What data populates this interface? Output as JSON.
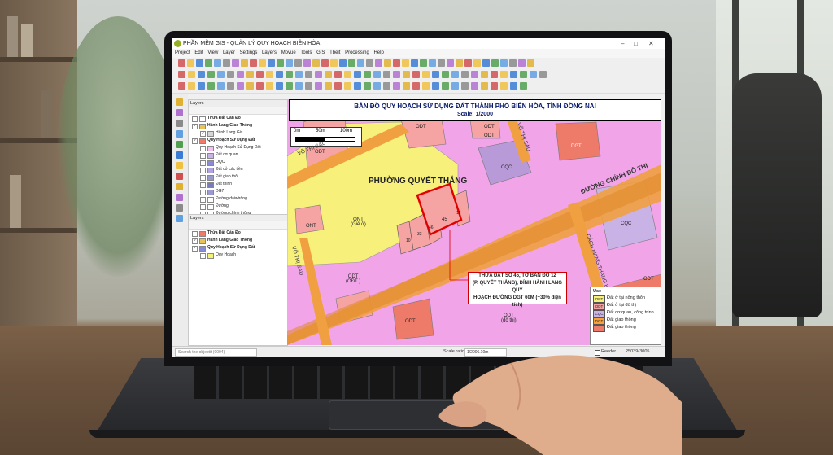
{
  "window": {
    "title": "PHẦN MỀM GIS - QUẢN LÝ QUY HOẠCH BIÊN HÒA",
    "controls": [
      "–",
      "□",
      "✕"
    ]
  },
  "menu": [
    "Project",
    "Edit",
    "View",
    "Layer",
    "Settings",
    "Layers",
    "Movue",
    "Tools",
    "GIS",
    "Tbeit",
    "Processing",
    "Help"
  ],
  "layers_panel_1": {
    "title": "Layers",
    "items": [
      {
        "label": "Thửa Đất Cán Đo",
        "bold": true,
        "checked": false,
        "swatch": "#ffffff"
      },
      {
        "label": "Hành Lang Giao Thông",
        "bold": true,
        "checked": true,
        "swatch": "#e8c35a"
      },
      {
        "label": "Hành Lang Gis",
        "bold": false,
        "checked": true,
        "swatch": "#d6d6d6"
      },
      {
        "label": "Quy Hoạch Sử Dụng Đất",
        "bold": true,
        "checked": true,
        "swatch": "#f07a6a"
      },
      {
        "label": "Quy Hoạch Sử Dụng Đất",
        "bold": false,
        "checked": false,
        "swatch": "#f5c1ee"
      },
      {
        "label": "Đất cơ quan",
        "bold": false,
        "checked": false,
        "swatch": "#c9b2e6"
      },
      {
        "label": "OQC",
        "bold": false,
        "checked": false,
        "swatch": "#8a8ad6"
      },
      {
        "label": "Đất cở các tiền",
        "bold": false,
        "checked": false,
        "swatch": "#b0a5e0"
      },
      {
        "label": "Đất giao thô",
        "bold": false,
        "checked": false,
        "swatch": "#9999cc"
      },
      {
        "label": "Đất thinh",
        "bold": false,
        "checked": false,
        "swatch": "#7a7ab8"
      },
      {
        "label": "DG7",
        "bold": false,
        "checked": false,
        "swatch": "#9b9bd0"
      },
      {
        "label": "Đường daiwtrông",
        "bold": false,
        "checked": false,
        "swatch": "#ffffff"
      },
      {
        "label": "Đường",
        "bold": false,
        "checked": false,
        "swatch": "#ffffff"
      },
      {
        "label": "Đường chính thông",
        "bold": false,
        "checked": false,
        "swatch": "#ffffff"
      }
    ]
  },
  "layers_panel_2": {
    "title": "Layers",
    "items": [
      {
        "label": "Thửa Đất Cán Đo",
        "bold": true,
        "checked": false,
        "swatch": "#f07a6a"
      },
      {
        "label": "Hành Lang Giao Thông",
        "bold": true,
        "checked": true,
        "swatch": "#e8c35a"
      },
      {
        "label": "Quy Hoạch Sử Dụng Đất",
        "bold": true,
        "checked": true,
        "swatch": "#8a8ad6"
      },
      {
        "label": "Quy Hoạch",
        "bold": false,
        "checked": false,
        "swatch": "#f5f07a"
      }
    ]
  },
  "map": {
    "title_line1": "BẢN ĐỒ QUY HOẠCH SỬ DỤNG ĐẤT THÀNH PHỐ BIÊN HÒA, TỈNH ĐỒNG NAI",
    "title_line2": "Scale: 1/2000",
    "scalebar": [
      "0m",
      "50m",
      "100m"
    ],
    "ward": "PHƯỜNG QUYẾT THẮNG",
    "streets": {
      "vo_thi_sau_1": "VÕ THỊ SÁU",
      "vo_thi_sau_2": "VÕ THỊ SÁU",
      "vo_thi_sau_3": "VÕ THỊ SÁU",
      "main_road": "ĐƯỜNG CHÍNH ĐÔ THỊ",
      "cach_mang": "CÁCH MẠNG THÁNG 8"
    },
    "zones": {
      "odt1": "ODT",
      "odt2": "ODT",
      "odt3": "ODT",
      "odt4": "ODT",
      "odt5_code": "ODT",
      "odt5_sub": "(OĐT )",
      "odt6": "ODT",
      "odt7_code": "ODT",
      "odt7_sub": "(đô thị)",
      "odt8": "ODT",
      "ont1": "ONT",
      "ont2_code": "ONT",
      "ont2_sub": "(Giê ở)",
      "dgt": "DGT",
      "cqc1": "CQC",
      "cqc2": "CQC"
    },
    "parcels": [
      "10",
      "33",
      "46",
      "45",
      "12"
    ],
    "callout": "THỬA ĐẤT SỐ 45, TỜ BẢN ĐỒ 12 (P. QUYẾT THẮNG), DÍNH HÀNH LANG QUY HOẠCH ĐƯỜNG DGT 60M (~30% diện tích)",
    "callout_l1": "THỬA ĐẤT SỐ 45, TỜ BẢN ĐỒ 12",
    "callout_l2": "(P. QUYẾT THẮNG), DÍNH HÀNH LANG QUY",
    "callout_l3": "HOẠCH ĐƯỜNG DGT 60M (~30% diện tích)"
  },
  "legend": {
    "title": "Use",
    "items": [
      {
        "code": "ONT",
        "label": "Đất ở tại nông thôn",
        "color": "#f7f07a"
      },
      {
        "code": "ODT",
        "label": "Đất ở tại đô thị",
        "color": "#f5a3a3"
      },
      {
        "code": "CQC",
        "label": "Đất cơ quan, công trình",
        "color": "#c9b2e6"
      },
      {
        "code": "DGT",
        "label": "Đất giao thông",
        "color": "#f6a23a"
      },
      {
        "code": "",
        "label": "Đất giao thông",
        "color": "#ee7a6a"
      }
    ]
  },
  "statusbar": {
    "search_placeholder": "Search the objectit (0004)",
    "scale_label": "Scale ratio",
    "scale_value": "1/2006.10m",
    "render_label": "Reeder",
    "crs": "25039•3005"
  },
  "colors": {
    "ont": "#f7f07a",
    "odt": "#f5a3a3",
    "pink_zone": "#f1a4e8",
    "road": "#f0a040",
    "cqc": "#c9b2e6",
    "highlight": "#e00000"
  }
}
